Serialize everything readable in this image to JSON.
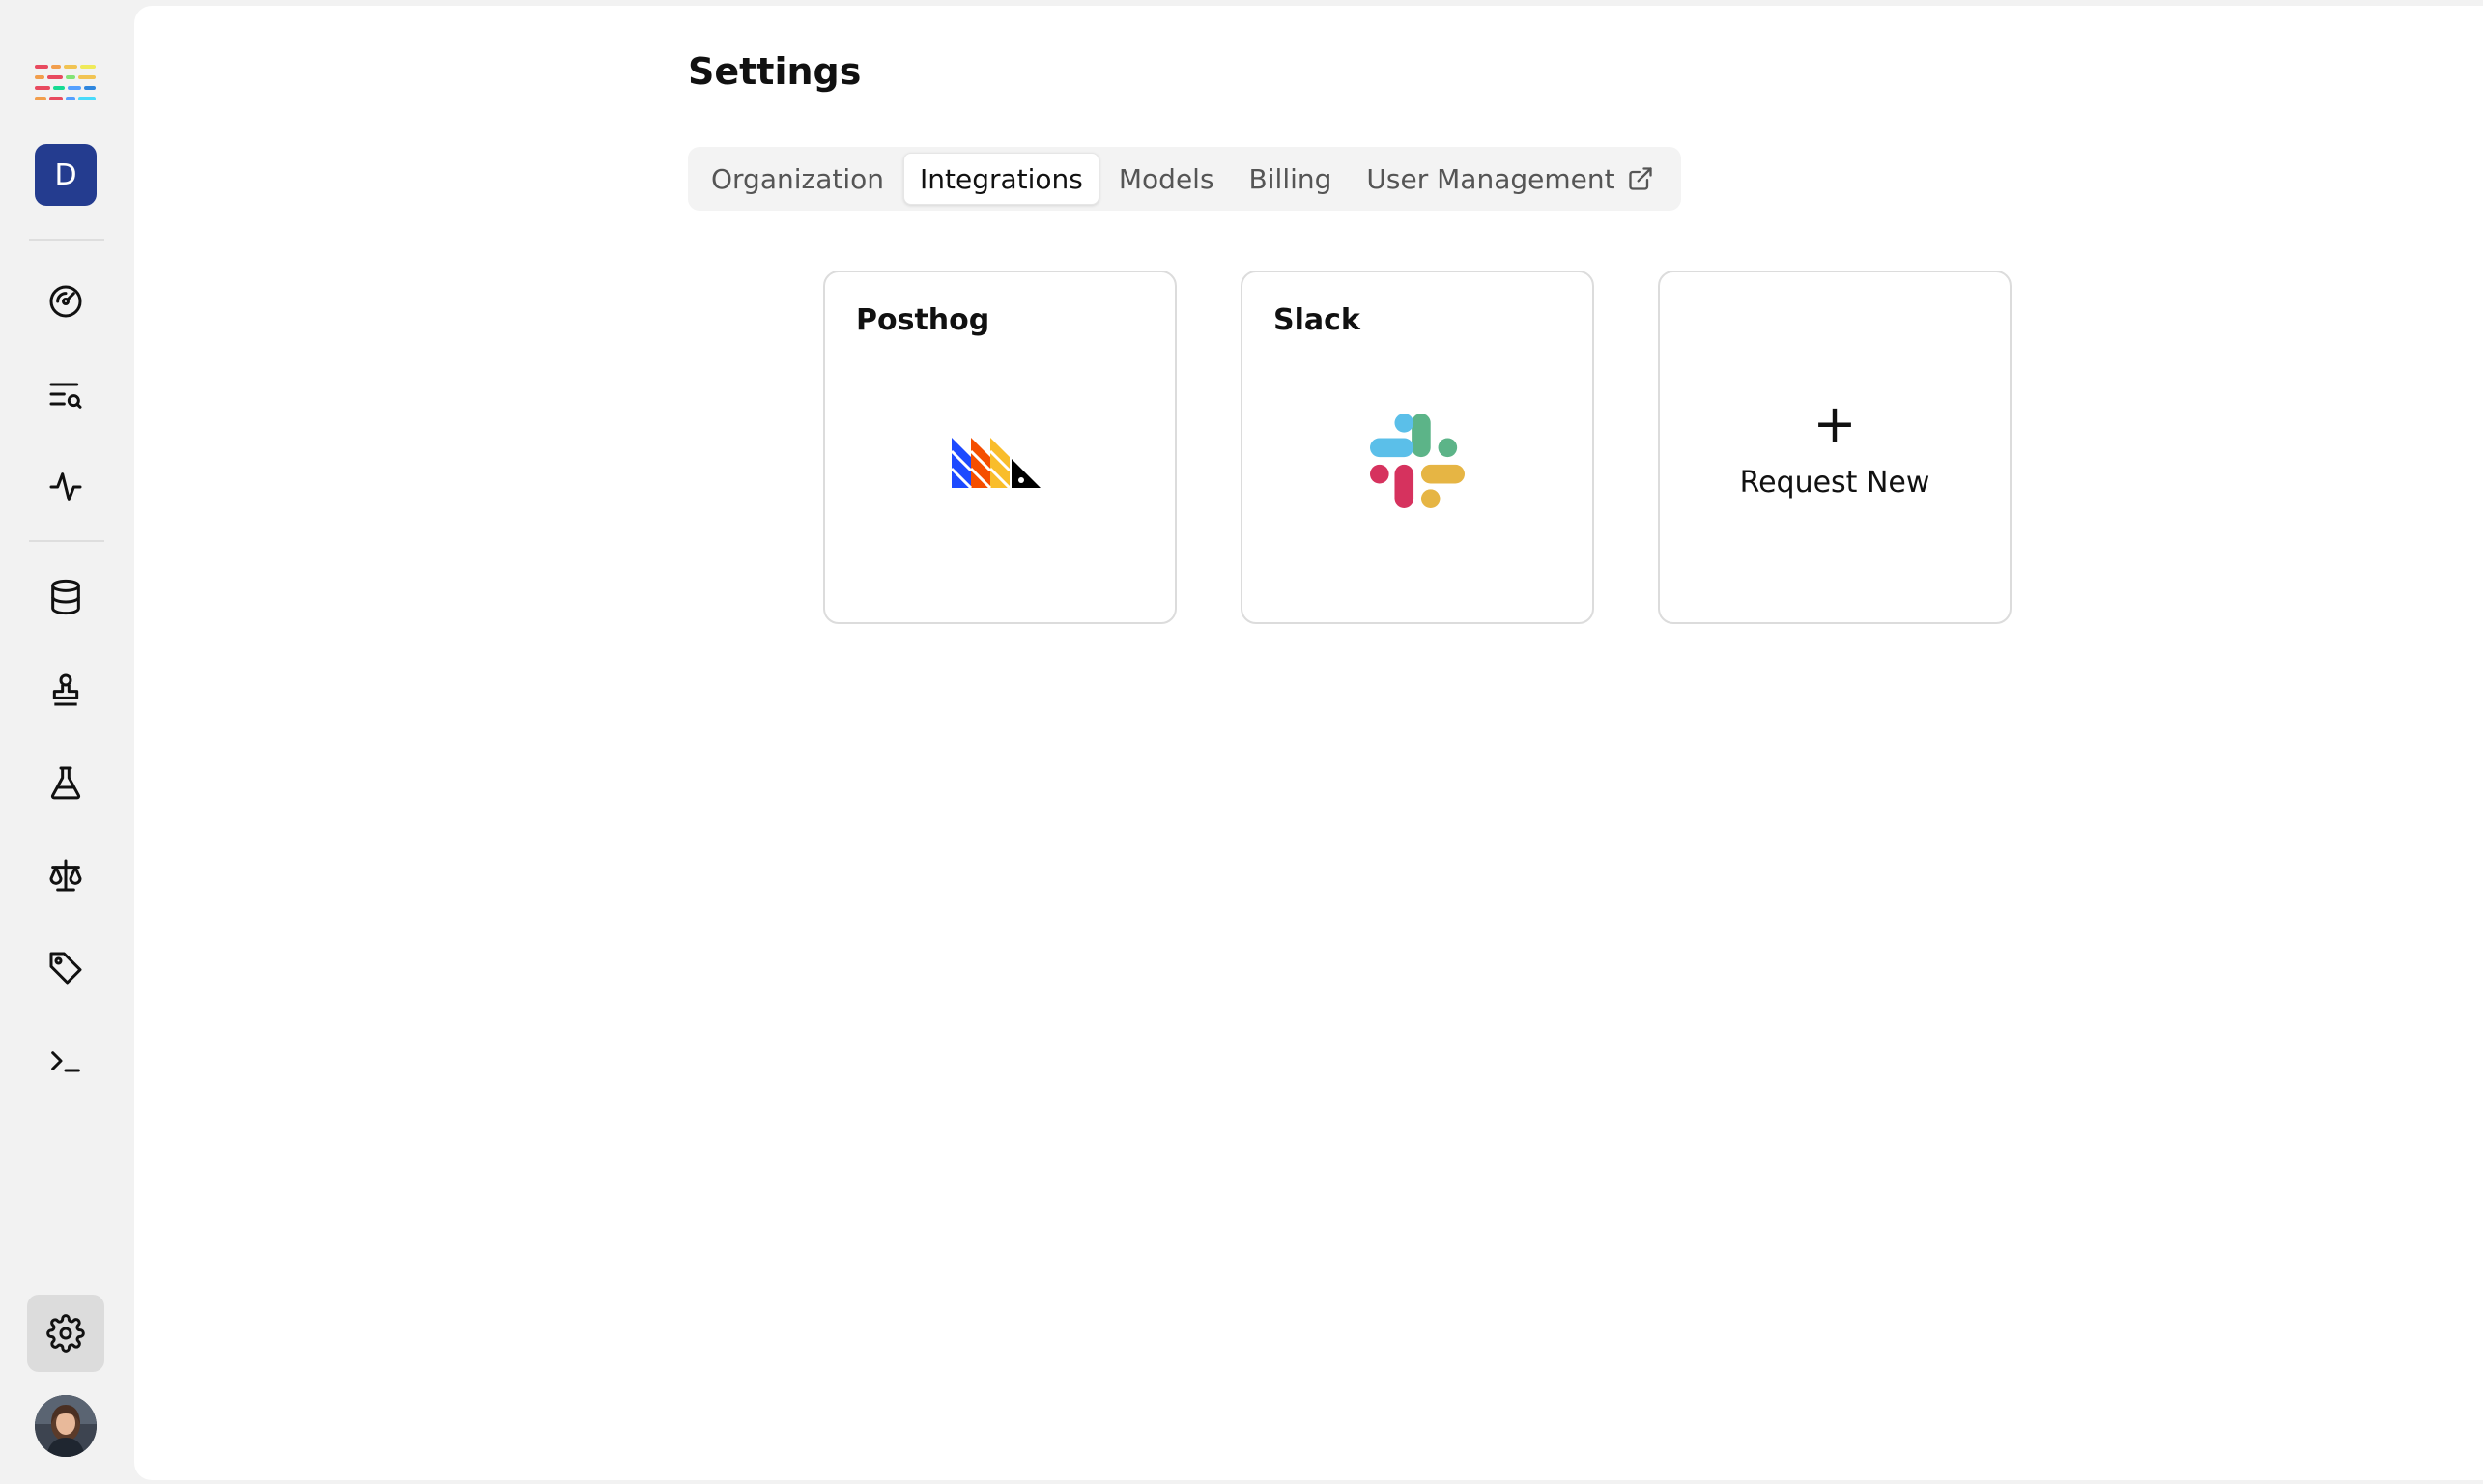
{
  "sidebar": {
    "org_initial": "D",
    "icons": [
      "dashboard-gauge-icon",
      "search-list-icon",
      "activity-icon",
      "database-icon",
      "stamp-icon",
      "flask-icon",
      "scale-icon",
      "tag-icon",
      "terminal-icon",
      "gear-icon"
    ],
    "active_item": "gear-icon"
  },
  "page": {
    "title": "Settings"
  },
  "tabs": [
    {
      "label": "Organization",
      "active": false
    },
    {
      "label": "Integrations",
      "active": true
    },
    {
      "label": "Models",
      "active": false
    },
    {
      "label": "Billing",
      "active": false
    },
    {
      "label": "User Management",
      "active": false,
      "external": true
    }
  ],
  "integrations": [
    {
      "name": "Posthog",
      "logo": "posthog-logo"
    },
    {
      "name": "Slack",
      "logo": "slack-logo"
    }
  ],
  "request_card": {
    "plus": "+",
    "label": "Request New"
  },
  "colors": {
    "org_badge": "#243c8f",
    "active_tab_bg": "#ffffff",
    "slack_blue": "#5bbfe9",
    "slack_green": "#5cb488",
    "slack_red": "#d6325e",
    "slack_yellow": "#e6b544"
  }
}
